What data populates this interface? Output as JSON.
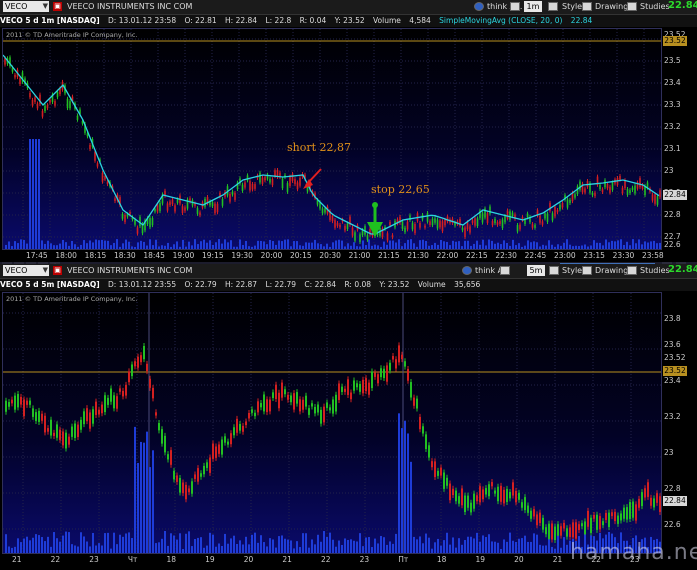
{
  "top": {
    "symbol": "VECO",
    "company": "VEECO INSTRUMENTS INC COM",
    "think_label": "think A.I.",
    "timeframe": "1m",
    "style_label": "Style",
    "drawings_label": "Drawings",
    "studies_label": "Studies",
    "last_price": "22.84",
    "quote": {
      "title": "VECO 5 d 1m [NASDAQ]",
      "date": "D: 13.01.12 23:58",
      "open": "O: 22.81",
      "high": "H: 22.84",
      "low": "L: 22.8",
      "range": "R: 0.04",
      "vwap": "Y: 23.52",
      "volume_label": "Volume",
      "volume": "4,584",
      "study": "SimpleMovingAvg (CLOSE, 20, 0)",
      "study_value": "22.84"
    },
    "copyright": "2011 © TD Ameritrade IP Company, Inc.",
    "price_ticks": [
      "23.52",
      "23.5",
      "23.4",
      "23.3",
      "23.2",
      "23.1",
      "23",
      "22.9",
      "22.8",
      "22.7",
      "22.6"
    ],
    "price_tag": "22.84",
    "level_tag": "23.52",
    "time_ticks": [
      "17:45",
      "18:00",
      "18:15",
      "18:30",
      "18:45",
      "19:00",
      "19:15",
      "19:30",
      "20:00",
      "20:15",
      "20:30",
      "21:00",
      "21:15",
      "21:30",
      "22:00",
      "22:15",
      "22:30",
      "22:45",
      "23:00",
      "23:15",
      "23:30",
      "23:58"
    ],
    "annotations": {
      "short": "short 22,87",
      "stop": "stop 22,65"
    }
  },
  "bottom": {
    "symbol": "VECO",
    "company": "VEECO INSTRUMENTS INC COM",
    "think_label": "think A.I.",
    "timeframe": "5m",
    "style_label": "Style",
    "drawings_label": "Drawings",
    "studies_label": "Studies",
    "last_price": "22.84",
    "quote": {
      "title": "VECO 5 d 5m [NASDAQ]",
      "date": "D: 13.01.12 23:55",
      "open": "O: 22.79",
      "high": "H: 22.87",
      "low": "L: 22.79",
      "close": "C: 22.84",
      "range": "R: 0.08",
      "vwap": "Y: 23.52",
      "volume_label": "Volume",
      "volume": "35,656"
    },
    "copyright": "2011 © TD Ameritrade IP Company, Inc.",
    "price_ticks": [
      "23.8",
      "23.6",
      "23.52",
      "23.4",
      "23.2",
      "23",
      "22.8",
      "22.6"
    ],
    "price_tag": "22.84",
    "level_tag": "23.52",
    "day_ticks": [
      "21",
      "22",
      "23",
      "Чт",
      "18",
      "19",
      "20",
      "21",
      "22",
      "23",
      "Пт",
      "18",
      "19",
      "20",
      "21",
      "22",
      "23"
    ]
  },
  "colors": {
    "up": "#22c022",
    "down": "#d42020",
    "sma": "#2bd5e0",
    "volume": "#1e3cd8",
    "level": "#b89020",
    "accent_green": "#2bd82b"
  },
  "watermark": "hamaha.net"
}
